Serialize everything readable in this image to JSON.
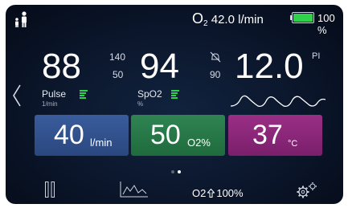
{
  "status": {
    "o2_label": "O",
    "o2_sub": "2",
    "o2_flow": "42.0 l/min",
    "battery_pct": "100 %",
    "battery_color": "#2fd24b"
  },
  "vitals": {
    "pulse": {
      "value": "88",
      "alarm_high": "140",
      "alarm_low": "50",
      "label": "Pulse",
      "unit": "1/min"
    },
    "spo2": {
      "value": "94",
      "alarm_low": "90",
      "label": "SpO2",
      "unit": "%"
    },
    "pi": {
      "value": "12.0",
      "label": "PI"
    }
  },
  "tiles": {
    "flow": {
      "value": "40",
      "unit": "l/min",
      "color": "#3a5c9c"
    },
    "fio2": {
      "value": "50",
      "unit": "O2%",
      "color": "#2f8452"
    },
    "temp": {
      "value": "37",
      "unit": "°C",
      "color": "#9a2f86"
    }
  },
  "pager": {
    "pages": 2,
    "active": 2
  },
  "bottom": {
    "o2_boost": "O2",
    "o2_boost_pct": "100%"
  },
  "icons": [
    "family-icon",
    "battery-icon",
    "mute-alarm-icon",
    "back-chevron-icon",
    "pause-icon",
    "trend-chart-icon",
    "arrow-up-icon",
    "settings-icon"
  ]
}
